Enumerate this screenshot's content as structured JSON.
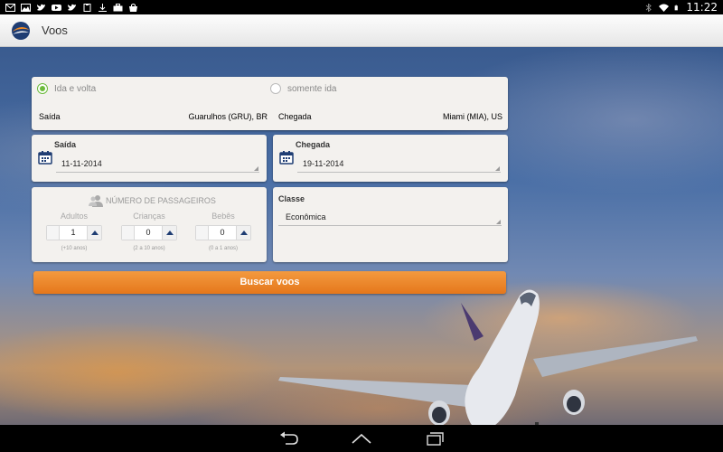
{
  "status_bar": {
    "time": "11:22",
    "left_icons": [
      "mail-icon",
      "image-icon",
      "twitter-icon",
      "youtube-icon",
      "twitter-icon",
      "clipboard-icon",
      "download-icon",
      "briefcase-icon",
      "shopping-bag-icon"
    ],
    "right_icons": [
      "bluetooth-icon",
      "wifi-icon",
      "battery-icon"
    ]
  },
  "action_bar": {
    "title": "Voos",
    "logo_icon": "app-logo-icon"
  },
  "trip_type": {
    "options": [
      {
        "label": "Ida e volta",
        "selected": true
      },
      {
        "label": "somente ida",
        "selected": false
      }
    ],
    "origin_label": "Saída",
    "origin_value": "Guarulhos (GRU), BR",
    "destination_label": "Chegada",
    "destination_value": "Miami (MIA), US"
  },
  "departure": {
    "label": "Saída",
    "date": "11-11-2014",
    "icon": "calendar-icon"
  },
  "return": {
    "label": "Chegada",
    "date": "19-11-2014",
    "icon": "calendar-icon"
  },
  "passengers": {
    "title": "NÚMERO DE PASSAGEIROS",
    "icon": "people-icon",
    "groups": [
      {
        "label": "Adultos",
        "value": "1",
        "hint": "(+10 anos)"
      },
      {
        "label": "Crianças",
        "value": "0",
        "hint": "(2 a 10 anos)"
      },
      {
        "label": "Bebês",
        "value": "0",
        "hint": "(0 a 1 anos)"
      }
    ]
  },
  "cabin_class": {
    "label": "Classe",
    "value": "Econômica"
  },
  "search_button": {
    "label": "Buscar voos",
    "color": "#ec8a2e"
  },
  "nav_bar": {
    "icons": [
      "back-icon",
      "home-icon",
      "recent-apps-icon"
    ]
  },
  "colors": {
    "accent_green": "#6cbb3c",
    "button_orange": "#ec8a2e",
    "stepper_arrow": "#1f3d73"
  }
}
